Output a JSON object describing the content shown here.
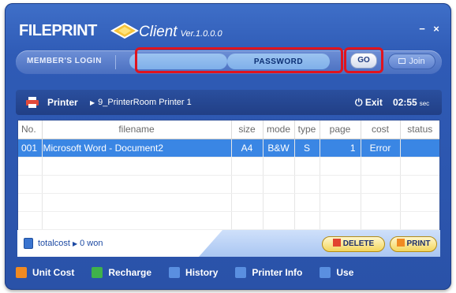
{
  "app": {
    "brand_bold": "FILE",
    "brand_bold2": "PRINT",
    "client": "Client",
    "version": "Ver.1.0.0.0",
    "minimize": "−",
    "close": "×"
  },
  "login": {
    "member_label": "MEMBER'S LOGIN",
    "id_value": "",
    "password_placeholder": "PASSWORD",
    "go_label": "GO",
    "join_label": "Join"
  },
  "printer": {
    "label": "Printer",
    "name": "9_PrinterRoom Printer 1",
    "exit_label": "Exit",
    "timer": "02:55",
    "timer_unit": "sec"
  },
  "table": {
    "headers": [
      "No.",
      "filename",
      "size",
      "mode",
      "type",
      "page",
      "cost",
      "status"
    ],
    "rows": [
      {
        "no": "001",
        "filename": "Microsoft Word - Document2",
        "size": "A4",
        "mode": "B&W",
        "type": "S",
        "page": "1",
        "cost": "Error",
        "status": ""
      }
    ]
  },
  "footer": {
    "totalcost_label": "totalcost",
    "totalcost_value": "0 won",
    "delete_label": "DELETE",
    "print_label": "PRINT"
  },
  "menu": {
    "items": [
      {
        "label": "Unit Cost",
        "icon": "unit-cost-icon",
        "color": "#f08a22"
      },
      {
        "label": "Recharge",
        "icon": "recharge-icon",
        "color": "#3fb24a"
      },
      {
        "label": "History",
        "icon": "history-icon",
        "color": "#5a8fe0"
      },
      {
        "label": "Printer Info",
        "icon": "printer-info-icon",
        "color": "#5a8fe0"
      },
      {
        "label": "Use",
        "icon": "use-icon",
        "color": "#5a8fe0"
      }
    ]
  },
  "colors": {
    "accent": "#2a52a8",
    "selection": "#3a86e4",
    "highlight": "#e0141e"
  }
}
